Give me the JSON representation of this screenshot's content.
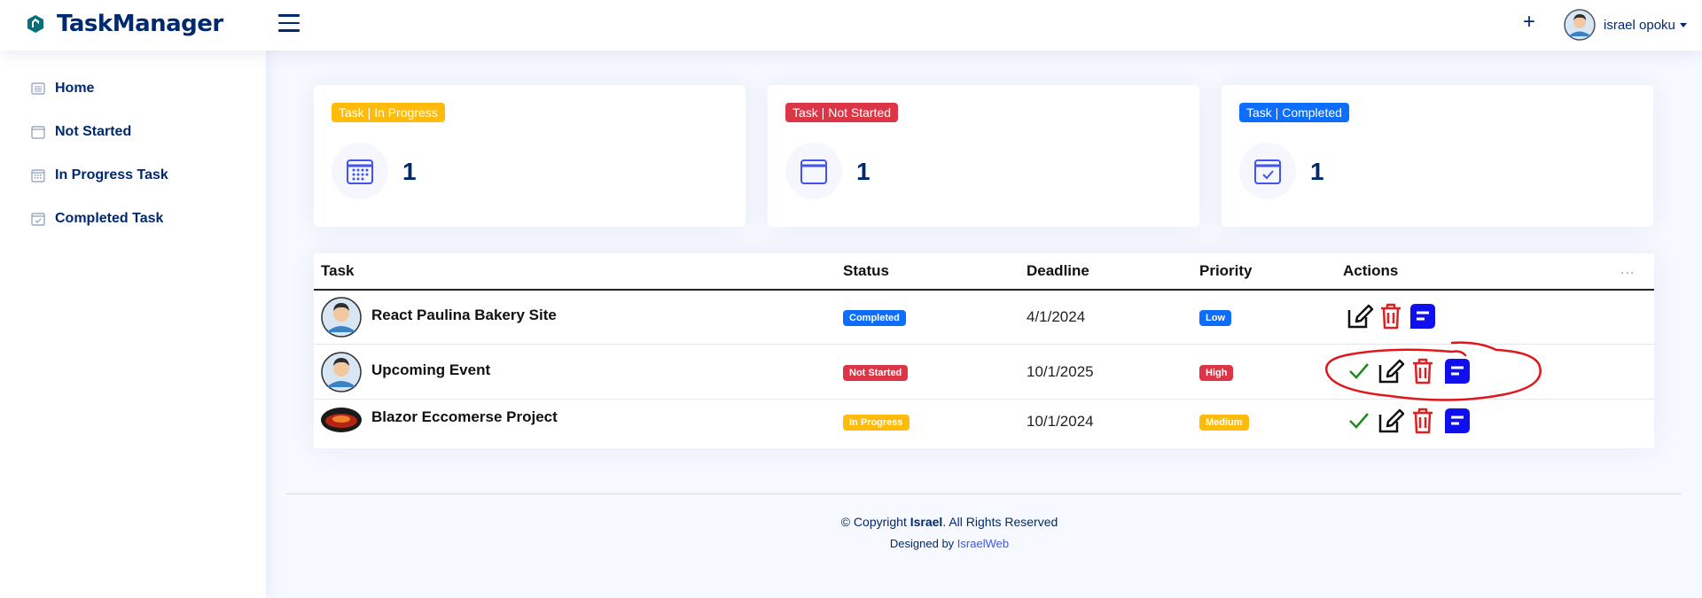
{
  "app": {
    "title": "TaskManager"
  },
  "header": {
    "user_name": "israel opoku",
    "add_icon": "plus-icon",
    "menu_icon": "hamburger-icon"
  },
  "sidebar": {
    "items": [
      {
        "label": "Home",
        "icon": "list-icon"
      },
      {
        "label": "Not Started",
        "icon": "calendar-icon"
      },
      {
        "label": "In Progress Task",
        "icon": "calendar-grid-icon"
      },
      {
        "label": "Completed Task",
        "icon": "calendar-check-icon"
      }
    ]
  },
  "cards": [
    {
      "badge": "Task | In Progress",
      "value": "1",
      "badge_color": "#ffbb0a"
    },
    {
      "badge": "Task | Not Started",
      "value": "1",
      "badge_color": "#dc3545"
    },
    {
      "badge": "Task | Completed",
      "value": "1",
      "badge_color": "#0d6efd"
    }
  ],
  "table": {
    "columns": [
      "Task",
      "Status",
      "Deadline",
      "Priority",
      "Actions"
    ],
    "more_label": "...",
    "rows": [
      {
        "task": "React Paulina Bakery Site",
        "status": "Completed",
        "status_color": "#0d6efd",
        "deadline": "4/1/2024",
        "priority": "Low",
        "priority_color": "#0d6efd",
        "show_complete": false
      },
      {
        "task": "Upcoming Event",
        "status": "Not Started",
        "status_color": "#dc3545",
        "deadline": "10/1/2025",
        "priority": "High",
        "priority_color": "#dc3545",
        "show_complete": true
      },
      {
        "task": "Blazor Eccomerse Project",
        "status": "In Progress",
        "status_color": "#ffbb0a",
        "deadline": "10/1/2024",
        "priority": "Medium",
        "priority_color": "#ffbb0a",
        "show_complete": true
      }
    ]
  },
  "footer": {
    "copyright_prefix": "© Copyright ",
    "copyright_owner": "Israel",
    "copyright_suffix": ". All Rights Reserved",
    "designed_by_prefix": "Designed by ",
    "designed_by_link": "IsraelWeb"
  },
  "colors": {
    "brand": "#012970",
    "accent": "#4154f1",
    "delete": "#e02020",
    "message": "#1010ee",
    "check": "#1f8a1f"
  }
}
